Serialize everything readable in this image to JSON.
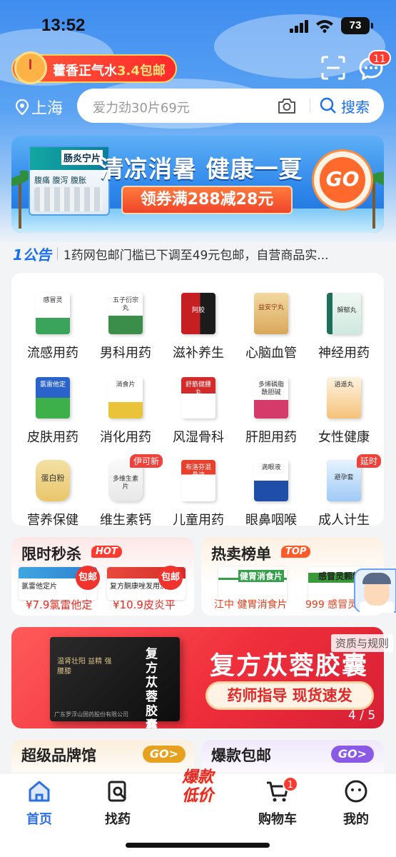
{
  "status": {
    "time": "13:52",
    "battery": "73"
  },
  "header": {
    "promo_text": "藿香正气水",
    "promo_highlight": "3.4包邮",
    "message_badge": "11",
    "location": "上海",
    "search_placeholder": "爱力劲30片69元",
    "search_button": "搜索"
  },
  "hero": {
    "title": "清凉消暑 健康一夏",
    "coupon": "领券满288减28元",
    "go": "GO",
    "product_label": "肠炎宁片",
    "product_sub": "腹痛 腹泻 腹胀"
  },
  "notice": {
    "tag": "1公告",
    "text": "1药网包邮门槛已下调至49元包邮，自营商品实..."
  },
  "categories": [
    {
      "label": "流感用药",
      "pkg": "感冒灵"
    },
    {
      "label": "男科用药",
      "pkg": "五子衍宗丸"
    },
    {
      "label": "滋补养生",
      "pkg": "阿胶"
    },
    {
      "label": "心脑血管",
      "pkg": "益安宁丸"
    },
    {
      "label": "神经用药",
      "pkg": "解郁丸"
    },
    {
      "label": "皮肤用药",
      "pkg": "氯雷他定"
    },
    {
      "label": "消化用药",
      "pkg": "消食片"
    },
    {
      "label": "风湿骨科",
      "pkg": "舒筋健腰丸"
    },
    {
      "label": "肝胆用药",
      "pkg": "多烯磷脂酰胆碱"
    },
    {
      "label": "女性健康",
      "pkg": "逍遥丸"
    },
    {
      "label": "营养保健",
      "pkg": "蛋白粉"
    },
    {
      "label": "维生素钙",
      "pkg": "多维生素片",
      "badge": "伊可新"
    },
    {
      "label": "儿童用药",
      "pkg": "布洛芬混悬液"
    },
    {
      "label": "眼鼻咽喉",
      "pkg": "滴眼液"
    },
    {
      "label": "成人计生",
      "pkg": "避孕套",
      "badge": "延时"
    }
  ],
  "flash": {
    "title": "限时秒杀",
    "tag": "HOT",
    "items": [
      {
        "name": "氯雷他定片",
        "price": "¥7.9氯雷他定",
        "tag": "包邮"
      },
      {
        "name": "复方酮康唑发用洗剂",
        "price": "¥10.9皮炎平",
        "tag": "包邮"
      }
    ]
  },
  "hot": {
    "title": "热卖榜单",
    "tag": "TOP",
    "items": [
      {
        "name": "健胃消食片",
        "caption": "江中 健胃消食片"
      },
      {
        "name": "感冒灵颗粒",
        "caption": "999 感冒灵颗粒"
      }
    ]
  },
  "banner": {
    "title": "复方苁蓉胶囊",
    "pill": "药师指导 现货速发",
    "qualification": "资质与规则",
    "pager": "4 / 5",
    "box_name": "复方苁蓉胶囊"
  },
  "bottom_cards": [
    {
      "title": "超级品牌馆",
      "go": "GO>"
    },
    {
      "title": "爆款包邮",
      "go": "GO>"
    }
  ],
  "tabbar": {
    "home": "首页",
    "find": "找药",
    "center": "爆款低价",
    "cart": "购物车",
    "cart_badge": "1",
    "mine": "我的"
  }
}
